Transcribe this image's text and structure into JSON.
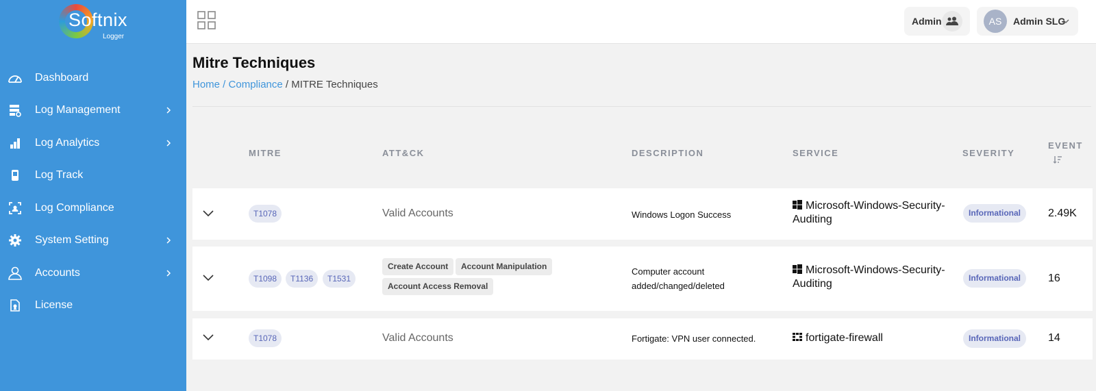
{
  "brand": {
    "name": "Softnix",
    "sub": "Logger"
  },
  "sidebar": {
    "items": [
      {
        "label": "Dashboard",
        "icon": "dashboard-icon",
        "has_children": false
      },
      {
        "label": "Log Management",
        "icon": "server-icon",
        "has_children": true
      },
      {
        "label": "Log Analytics",
        "icon": "chart-icon",
        "has_children": true
      },
      {
        "label": "Log Track",
        "icon": "device-icon",
        "has_children": false
      },
      {
        "label": "Log Compliance",
        "icon": "scan-icon",
        "has_children": false
      },
      {
        "label": "System Setting",
        "icon": "gear-icon",
        "has_children": true
      },
      {
        "label": "Accounts",
        "icon": "user-icon",
        "has_children": true
      },
      {
        "label": "License",
        "icon": "license-icon",
        "has_children": false
      }
    ]
  },
  "header": {
    "role_label": "Admin",
    "avatar_initials": "AS",
    "user_name": "Admin SLG"
  },
  "page": {
    "title": "Mitre Techniques",
    "breadcrumb": {
      "home": "Home",
      "sep": " / ",
      "compliance": "Compliance",
      "current": "MITRE Techniques"
    }
  },
  "table": {
    "columns": {
      "mitre": "MITRE",
      "attck": "ATT&CK",
      "description": "DESCRIPTION",
      "service": "SERVICE",
      "severity": "SEVERITY",
      "event": "EVENT"
    },
    "rows": [
      {
        "mitre": [
          "T1078"
        ],
        "attck_text": "Valid Accounts",
        "attck_tags": [],
        "description": "Windows Logon Success",
        "service": "Microsoft-Windows-Security-Auditing",
        "service_icon": "windows-icon",
        "severity": "Informational",
        "event": "2.49K"
      },
      {
        "mitre": [
          "T1098",
          "T1136",
          "T1531"
        ],
        "attck_text": "",
        "attck_tags": [
          "Create Account",
          "Account Manipulation",
          "Account Access Removal"
        ],
        "description": "Computer account added/changed/deleted",
        "service": "Microsoft-Windows-Security-Auditing",
        "service_icon": "windows-icon",
        "severity": "Informational",
        "event": "16"
      },
      {
        "mitre": [
          "T1078"
        ],
        "attck_text": "Valid Accounts",
        "attck_tags": [],
        "description": "Fortigate: VPN user connected.",
        "service": "fortigate-firewall",
        "service_icon": "fortinet-icon",
        "severity": "Informational",
        "event": "14"
      }
    ]
  },
  "colors": {
    "sidebar": "#3f95db",
    "link": "#3f95db",
    "tag_bg": "#e6e9f3",
    "tag_text": "#5866b8"
  }
}
